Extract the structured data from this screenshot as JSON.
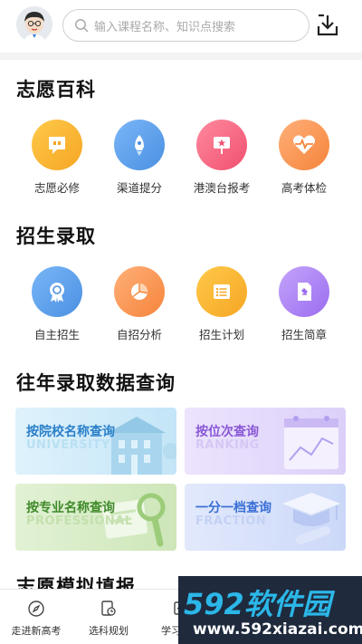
{
  "header": {
    "search_placeholder": "输入课程名称、知识点搜索"
  },
  "sections": {
    "zhiyuan": {
      "title": "志愿百科",
      "items": [
        {
          "label": "志愿必修",
          "icon": "message-quote-icon",
          "color": "#f5a623"
        },
        {
          "label": "渠道提分",
          "icon": "rocket-icon",
          "color": "#4a90e2"
        },
        {
          "label": "港澳台报考",
          "icon": "flag-star-icon",
          "color": "#f0506e"
        },
        {
          "label": "高考体检",
          "icon": "heartbeat-icon",
          "color": "#f5843a"
        }
      ]
    },
    "zhaosheng": {
      "title": "招生录取",
      "items": [
        {
          "label": "自主招生",
          "icon": "badge-icon",
          "color": "#4a90e2"
        },
        {
          "label": "自招分析",
          "icon": "pie-chart-icon",
          "color": "#f5843a"
        },
        {
          "label": "招生计划",
          "icon": "list-icon",
          "color": "#f5a623"
        },
        {
          "label": "招生简章",
          "icon": "document-icon",
          "color": "#9b6cf0"
        }
      ]
    },
    "history": {
      "title": "往年录取数据查询",
      "cards": [
        {
          "title": "按院校名称查询",
          "sub": "UNIVERSITY",
          "title_color": "#2a7fc9",
          "sub_color": "#b9e0f2",
          "bg": "#d6eefa"
        },
        {
          "title": "按位次查询",
          "sub": "RANKING",
          "title_color": "#8a58d6",
          "sub_color": "#dccdf6",
          "bg": "#e6ddfb"
        },
        {
          "title": "按专业名称查询",
          "sub": "PROFESSIONAL",
          "title_color": "#3f8a2a",
          "sub_color": "#cfe8bd",
          "bg": "#def0cf"
        },
        {
          "title": "一分一档查询",
          "sub": "FRACTION",
          "title_color": "#3a6fd6",
          "sub_color": "#c8d6f7",
          "bg": "#dbe4fb"
        }
      ]
    },
    "moni": {
      "title": "志愿模拟填报"
    }
  },
  "tabbar": {
    "items": [
      {
        "label": "走进新高考",
        "icon": "compass-icon"
      },
      {
        "label": "选科规划",
        "icon": "refresh-doc-icon"
      },
      {
        "label": "学习辅导",
        "icon": "study-icon"
      }
    ]
  },
  "watermark": {
    "main": "592软件园",
    "sub": "www.592xiazai.com"
  }
}
